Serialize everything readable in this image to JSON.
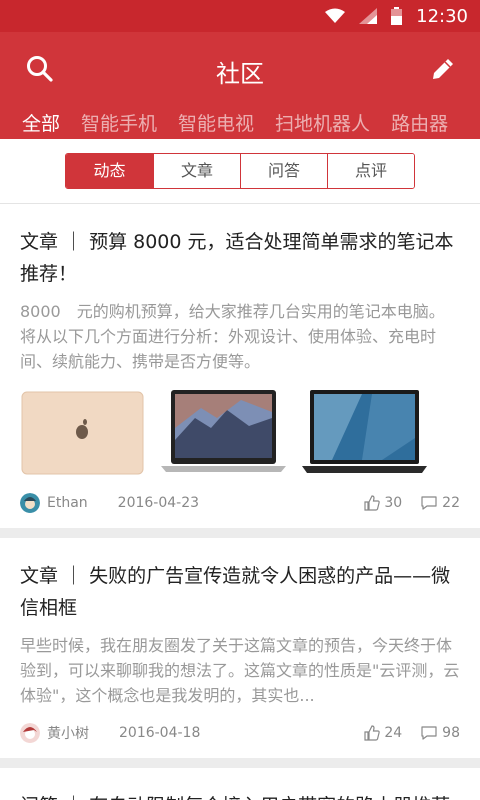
{
  "statusbar": {
    "time": "12:30"
  },
  "header": {
    "title": "社区",
    "tabs": [
      "全部",
      "智能手机",
      "智能电视",
      "扫地机器人",
      "路由器"
    ]
  },
  "segments": [
    "动态",
    "文章",
    "问答",
    "点评"
  ],
  "feed": [
    {
      "title": "文章 ｜ 预算 8000 元，适合处理简单需求的笔记本推荐！",
      "desc": "8000　元的购机预算，给大家推荐几台实用的笔记本电脑。将从以下几个方面进行分析：外观设计、使用体验、充电时间、续航能力、携带是否方便等。",
      "author": "Ethan",
      "date": "2016-04-23",
      "likes": "30",
      "comments": "22"
    },
    {
      "title": "文章 ｜ 失败的广告宣传造就令人困惑的产品——微信相框",
      "desc": "早些时候，我在朋友圈发了关于这篇文章的预告，今天终于体验到，可以来聊聊我的想法了。这篇文章的性质是\"云评测，云体验\"，这个概念也是我发明的，其实也...",
      "author": "黄小树",
      "date": "2016-04-18",
      "likes": "24",
      "comments": "98"
    },
    {
      "title": "问答 ｜ 有自动限制每个接入用户带宽的路由器推荐"
    }
  ],
  "colors": {
    "brand": "#d0353a",
    "statusbar": "#c8272d"
  }
}
